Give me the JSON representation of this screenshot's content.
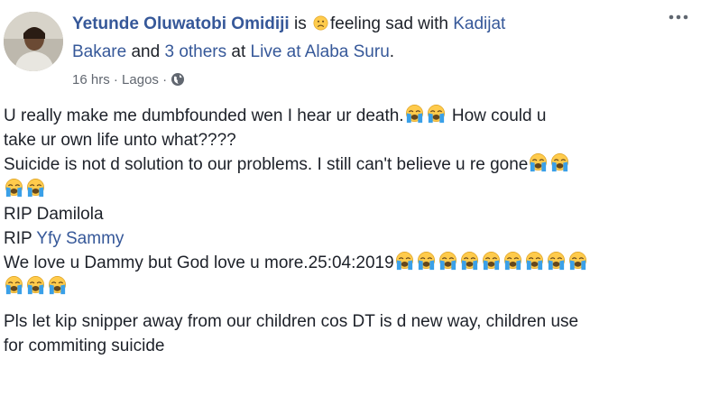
{
  "post": {
    "author": "Yetunde Oluwatobi Omidiji",
    "is_word": "is",
    "feeling_text": "feeling sad with",
    "tagged_first_part1": "Kadijat",
    "tagged_first_part2": "Bakare",
    "and_word": "and",
    "tagged_others": "3 others",
    "at_word": "at",
    "place": "Live at Alaba Suru",
    "period": ".",
    "time": "16 hrs",
    "sep1": "·",
    "location": "Lagos",
    "sep2": "·",
    "privacy_icon": "globe-icon",
    "more_icon": "more-options-icon",
    "feeling_icon": "sad-face-emoji",
    "crying_icon": "loudly-crying-face-emoji"
  },
  "body": {
    "line1": "U really make me dumbfounded wen I hear ur death.",
    "line1_tail": " How could u",
    "line2": "take ur own life unto what????",
    "line3": "Suicide is not d solution to our problems. I still can't believe u re gone",
    "line4": "RIP Damilola",
    "line5_prefix": "RIP ",
    "line5_link": "Yfy Sammy",
    "line6": "We love u Dammy but God love u more.25:04:2019",
    "line7": "Pls let kip snipper away from our children cos DT is d new way, children use",
    "line8": "for commiting suicide"
  },
  "colors": {
    "link": "#365899",
    "text": "#1d2129",
    "meta": "#616770",
    "emoji_face": "#ffc83d",
    "emoji_tears": "#3aa0e8"
  }
}
